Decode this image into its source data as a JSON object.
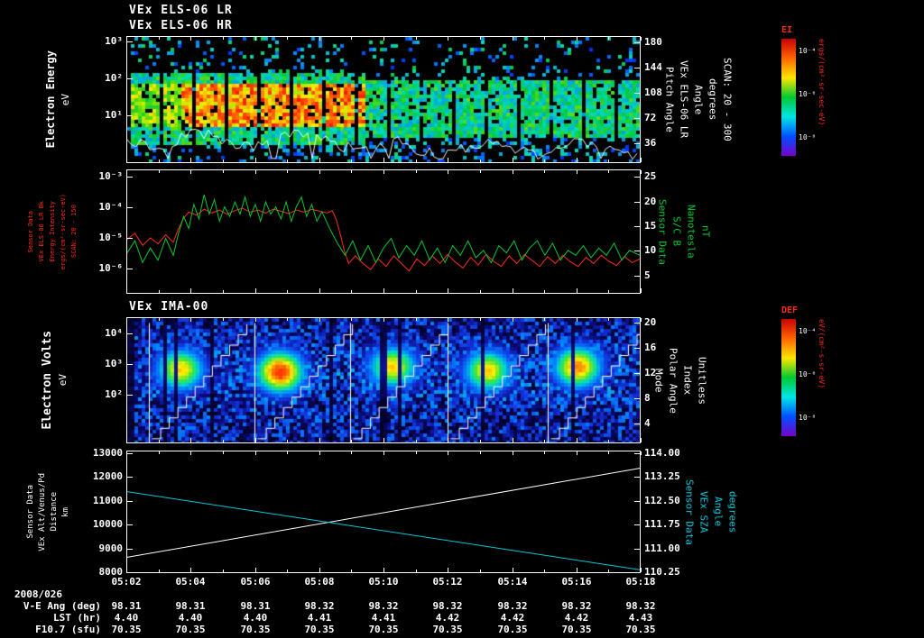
{
  "colors": {
    "background": "#000000",
    "foreground": "#ffffff",
    "red": "#ff2a1a",
    "green": "#00c832",
    "cyan": "#00c8dc",
    "white": "#ffffff"
  },
  "titles": {
    "line1": "VEx ELS-06 LR",
    "line2": "VEx ELS-06 HR",
    "ima": "VEx IMA-00"
  },
  "panel1": {
    "ylabel": "Electron Energy",
    "yunit": "eV",
    "yticks": [
      {
        "t": "10³",
        "f": 0.043
      },
      {
        "t": "10²",
        "f": 0.333
      },
      {
        "t": "10¹",
        "f": 0.624
      }
    ],
    "rticks": [
      {
        "t": "180",
        "f": 0.05
      },
      {
        "t": "144",
        "f": 0.249
      },
      {
        "t": "108",
        "f": 0.448
      },
      {
        "t": "72",
        "f": 0.647
      },
      {
        "t": "36",
        "f": 0.846
      }
    ],
    "side_labels": [
      "Pitch Angle",
      "VEx ELS-06 LR",
      "Angle",
      "degrees",
      "SCAN: 20 - 300"
    ],
    "colorbar": {
      "label": "EI",
      "units": "ergs/(cm²-sr-sec-eV)",
      "ticks": [
        {
          "t": "10⁻⁴",
          "f": 0.1
        },
        {
          "t": "10⁻⁶",
          "f": 0.47
        },
        {
          "t": "10⁻⁸",
          "f": 0.84
        }
      ]
    }
  },
  "panel2": {
    "left_labels": [
      "Sensor Data",
      "VEx ELS-06 LR Bk",
      "Energy Intensity",
      "ergs/(cm²-sr-sec-eV)",
      "SCAN: 20 - 150"
    ],
    "yticks": [
      {
        "t": "10⁻³",
        "f": 0.058
      },
      {
        "t": "10⁻⁴",
        "f": 0.304
      },
      {
        "t": "10⁻⁵",
        "f": 0.551
      },
      {
        "t": "10⁻⁶",
        "f": 0.797
      }
    ],
    "rticks": [
      {
        "t": "25",
        "f": 0.06
      },
      {
        "t": "20",
        "f": 0.258
      },
      {
        "t": "15",
        "f": 0.456
      },
      {
        "t": "10",
        "f": 0.654
      },
      {
        "t": "5",
        "f": 0.852
      }
    ],
    "side_labels": [
      "Sensor Data",
      "S/C B",
      "Nanotesla",
      "nT"
    ]
  },
  "panel3": {
    "ylabel": "Electron Volts",
    "yunit": "eV",
    "yticks": [
      {
        "t": "10⁴",
        "f": 0.129
      },
      {
        "t": "10³",
        "f": 0.371
      },
      {
        "t": "10²",
        "f": 0.614
      }
    ],
    "rticks": [
      {
        "t": "20",
        "f": 0.043
      },
      {
        "t": "16",
        "f": 0.243
      },
      {
        "t": "12",
        "f": 0.443
      },
      {
        "t": "8",
        "f": 0.643
      },
      {
        "t": "4",
        "f": 0.843
      }
    ],
    "side_labels": [
      "Mode",
      "Polar Angle",
      "Index",
      "Unitless"
    ],
    "colorbar": {
      "label": "DEF",
      "units": "eV/(cm²-s-sr-eV)",
      "ticks": [
        {
          "t": "10⁻⁴",
          "f": 0.1
        },
        {
          "t": "10⁻⁶",
          "f": 0.47
        },
        {
          "t": "10⁻⁸",
          "f": 0.84
        }
      ]
    }
  },
  "panel4": {
    "left_labels": [
      "Sensor Data",
      "VEx Alt/Venus/Pd",
      "Distance",
      "km"
    ],
    "yticks": [
      {
        "t": "13000",
        "f": 0.022
      },
      {
        "t": "12000",
        "f": 0.216
      },
      {
        "t": "11000",
        "f": 0.41
      },
      {
        "t": "10000",
        "f": 0.604
      },
      {
        "t": "9000",
        "f": 0.799
      },
      {
        "t": "8000",
        "f": 0.993
      }
    ],
    "rticks": [
      {
        "t": "114.00",
        "f": 0.022
      },
      {
        "t": "113.25",
        "f": 0.216
      },
      {
        "t": "112.50",
        "f": 0.41
      },
      {
        "t": "111.75",
        "f": 0.604
      },
      {
        "t": "111.00",
        "f": 0.799
      },
      {
        "t": "110.25",
        "f": 0.993
      }
    ],
    "side_labels": [
      "Sensor Data",
      "VEx SZA",
      "Angle",
      "degrees"
    ]
  },
  "time_axis": {
    "date": "2008/026",
    "ticks": [
      "05:02",
      "05:04",
      "05:06",
      "05:08",
      "05:10",
      "05:12",
      "05:14",
      "05:16",
      "05:18"
    ]
  },
  "info_rows": [
    {
      "label": "V-E Ang (deg)",
      "values": [
        "98.31",
        "98.31",
        "98.31",
        "98.32",
        "98.32",
        "98.32",
        "98.32",
        "98.32",
        "98.32"
      ]
    },
    {
      "label": "LST (hr)",
      "values": [
        "4.40",
        "4.40",
        "4.40",
        "4.41",
        "4.41",
        "4.42",
        "4.42",
        "4.42",
        "4.43"
      ]
    },
    {
      "label": "F10.7 (sfu)",
      "values": [
        "70.35",
        "70.35",
        "70.35",
        "70.35",
        "70.35",
        "70.35",
        "70.35",
        "70.35",
        "70.35"
      ]
    }
  ],
  "chart_data": [
    {
      "id": "els_spectrogram",
      "type": "heatmap",
      "title": "VEx ELS-06 HR",
      "ylabel": "Electron Energy (eV)",
      "yticks_log": [
        3,
        2,
        1
      ],
      "x_range": [
        "05:02",
        "05:18"
      ],
      "right_axis": {
        "label": "Pitch Angle (degrees)",
        "ticks": [
          180,
          144,
          108,
          72,
          36
        ],
        "scan": "SCAN: 20 - 300"
      },
      "colorbar": {
        "label": "EI",
        "units": "ergs/(cm²-sr-sec-eV)",
        "ticks_log": [
          -4,
          -6,
          -8
        ]
      },
      "features": {
        "seed": 11,
        "hot_band": {
          "x": [
            0.0,
            0.46
          ],
          "y": [
            0.36,
            0.7
          ]
        },
        "gap_period": 9,
        "gap_until": 1.0,
        "trace_base": 0.82
      }
    },
    {
      "id": "els_bk_and_b",
      "type": "line",
      "left_axis": {
        "label": "ergs/(cm²-sr-sec-eV)",
        "scale": "log10",
        "anchors": [
          [
            -3,
            0.058
          ],
          [
            -6,
            0.797
          ]
        ]
      },
      "right_axis": {
        "label": "S/C B (nT)",
        "anchors": [
          [
            25,
            0.06
          ],
          [
            5,
            0.852
          ]
        ]
      },
      "series": [
        {
          "name": "VEx ELS-06 LR Bk Energy Intensity",
          "color": "#ff2a1a",
          "axis": "left",
          "points": [
            [
              0.0,
              -5.05
            ],
            [
              0.015,
              -4.85
            ],
            [
              0.03,
              -5.25
            ],
            [
              0.045,
              -5.0
            ],
            [
              0.06,
              -5.2
            ],
            [
              0.075,
              -4.9
            ],
            [
              0.09,
              -5.15
            ],
            [
              0.1,
              -4.7
            ],
            [
              0.11,
              -4.35
            ],
            [
              0.12,
              -4.15
            ],
            [
              0.135,
              -4.25
            ],
            [
              0.15,
              -4.05
            ],
            [
              0.165,
              -4.18
            ],
            [
              0.18,
              -4.08
            ],
            [
              0.195,
              -4.22
            ],
            [
              0.21,
              -4.1
            ],
            [
              0.225,
              -4.02
            ],
            [
              0.24,
              -4.15
            ],
            [
              0.255,
              -4.08
            ],
            [
              0.27,
              -4.18
            ],
            [
              0.285,
              -4.05
            ],
            [
              0.3,
              -4.12
            ],
            [
              0.315,
              -4.2
            ],
            [
              0.33,
              -4.08
            ],
            [
              0.345,
              -4.15
            ],
            [
              0.36,
              -4.06
            ],
            [
              0.375,
              -4.12
            ],
            [
              0.39,
              -4.18
            ],
            [
              0.4,
              -4.1
            ],
            [
              0.408,
              -4.4
            ],
            [
              0.416,
              -4.9
            ],
            [
              0.424,
              -5.45
            ],
            [
              0.432,
              -5.85
            ],
            [
              0.445,
              -5.6
            ],
            [
              0.46,
              -5.85
            ],
            [
              0.475,
              -6.05
            ],
            [
              0.49,
              -5.7
            ],
            [
              0.505,
              -5.95
            ],
            [
              0.52,
              -5.6
            ],
            [
              0.535,
              -5.85
            ],
            [
              0.55,
              -6.1
            ],
            [
              0.565,
              -5.7
            ],
            [
              0.58,
              -5.92
            ],
            [
              0.595,
              -5.6
            ],
            [
              0.61,
              -5.85
            ],
            [
              0.625,
              -5.55
            ],
            [
              0.64,
              -5.8
            ],
            [
              0.655,
              -6.0
            ],
            [
              0.67,
              -5.65
            ],
            [
              0.685,
              -5.9
            ],
            [
              0.7,
              -5.55
            ],
            [
              0.715,
              -5.78
            ],
            [
              0.73,
              -5.95
            ],
            [
              0.745,
              -5.6
            ],
            [
              0.76,
              -5.85
            ],
            [
              0.775,
              -5.55
            ],
            [
              0.79,
              -5.75
            ],
            [
              0.805,
              -5.95
            ],
            [
              0.82,
              -5.62
            ],
            [
              0.835,
              -5.85
            ],
            [
              0.85,
              -5.58
            ],
            [
              0.865,
              -5.8
            ],
            [
              0.88,
              -5.95
            ],
            [
              0.895,
              -5.65
            ],
            [
              0.91,
              -5.85
            ],
            [
              0.925,
              -5.58
            ],
            [
              0.94,
              -5.78
            ],
            [
              0.955,
              -5.92
            ],
            [
              0.97,
              -5.62
            ],
            [
              0.985,
              -5.82
            ],
            [
              1.0,
              -5.7
            ]
          ]
        },
        {
          "name": "S/C B Nanotesla",
          "color": "#00c832",
          "axis": "right",
          "points": [
            [
              0.0,
              9.5
            ],
            [
              0.015,
              12.0
            ],
            [
              0.03,
              7.5
            ],
            [
              0.045,
              10.5
            ],
            [
              0.06,
              8.0
            ],
            [
              0.075,
              12.5
            ],
            [
              0.09,
              9.0
            ],
            [
              0.1,
              13.5
            ],
            [
              0.11,
              17.0
            ],
            [
              0.12,
              14.5
            ],
            [
              0.13,
              19.5
            ],
            [
              0.14,
              16.5
            ],
            [
              0.15,
              21.5
            ],
            [
              0.16,
              17.5
            ],
            [
              0.17,
              20.5
            ],
            [
              0.18,
              16.0
            ],
            [
              0.19,
              19.0
            ],
            [
              0.2,
              17.0
            ],
            [
              0.21,
              20.0
            ],
            [
              0.22,
              17.5
            ],
            [
              0.23,
              21.0
            ],
            [
              0.24,
              17.0
            ],
            [
              0.25,
              19.5
            ],
            [
              0.26,
              16.0
            ],
            [
              0.27,
              20.0
            ],
            [
              0.28,
              17.5
            ],
            [
              0.29,
              19.0
            ],
            [
              0.3,
              16.5
            ],
            [
              0.31,
              20.0
            ],
            [
              0.32,
              16.0
            ],
            [
              0.33,
              19.0
            ],
            [
              0.34,
              21.0
            ],
            [
              0.35,
              17.0
            ],
            [
              0.36,
              19.5
            ],
            [
              0.37,
              16.0
            ],
            [
              0.38,
              18.0
            ],
            [
              0.395,
              14.5
            ],
            [
              0.41,
              11.5
            ],
            [
              0.425,
              9.0
            ],
            [
              0.44,
              12.0
            ],
            [
              0.455,
              8.0
            ],
            [
              0.47,
              11.0
            ],
            [
              0.485,
              7.5
            ],
            [
              0.5,
              10.5
            ],
            [
              0.515,
              12.5
            ],
            [
              0.53,
              8.5
            ],
            [
              0.545,
              11.0
            ],
            [
              0.56,
              9.0
            ],
            [
              0.575,
              12.0
            ],
            [
              0.59,
              8.0
            ],
            [
              0.605,
              10.5
            ],
            [
              0.62,
              7.5
            ],
            [
              0.635,
              11.0
            ],
            [
              0.65,
              9.0
            ],
            [
              0.665,
              12.0
            ],
            [
              0.68,
              8.5
            ],
            [
              0.695,
              10.0
            ],
            [
              0.71,
              7.5
            ],
            [
              0.725,
              11.0
            ],
            [
              0.74,
              9.5
            ],
            [
              0.755,
              12.0
            ],
            [
              0.77,
              8.0
            ],
            [
              0.785,
              10.5
            ],
            [
              0.8,
              12.0
            ],
            [
              0.815,
              9.0
            ],
            [
              0.83,
              11.5
            ],
            [
              0.845,
              8.0
            ],
            [
              0.86,
              10.0
            ],
            [
              0.875,
              9.0
            ],
            [
              0.89,
              11.0
            ],
            [
              0.905,
              8.5
            ],
            [
              0.92,
              10.5
            ],
            [
              0.935,
              9.0
            ],
            [
              0.95,
              11.5
            ],
            [
              0.965,
              8.0
            ],
            [
              0.98,
              10.0
            ],
            [
              1.0,
              9.0
            ]
          ]
        }
      ]
    },
    {
      "id": "ima_spectrogram",
      "type": "heatmap",
      "title": "VEx IMA-00",
      "ylabel": "Electron Volts (eV)",
      "yticks_log": [
        4,
        3,
        2
      ],
      "right_axis": {
        "label": "Mode / Polar Angle Index (Unitless)",
        "ticks": [
          20,
          16,
          12,
          8,
          4
        ]
      },
      "colorbar": {
        "label": "DEF",
        "units": "eV/(cm²-s-sr-eV)",
        "ticks_log": [
          -4,
          -6,
          -8
        ]
      },
      "features": {
        "seed": 23,
        "blobs": [
          [
            0.1,
            0.4,
            0.85
          ],
          [
            0.295,
            0.42,
            1.0
          ],
          [
            0.515,
            0.38,
            0.85
          ],
          [
            0.7,
            0.41,
            0.85
          ],
          [
            0.875,
            0.38,
            0.92
          ]
        ],
        "sweep_starts": [
          0.042,
          0.248,
          0.435,
          0.625,
          0.82
        ]
      }
    },
    {
      "id": "alt_sza",
      "type": "line",
      "left_axis": {
        "label": "VEx Alt/Venus/Pd Distance (km)",
        "anchors": [
          [
            13000,
            0.022
          ],
          [
            8000,
            0.993
          ]
        ]
      },
      "right_axis": {
        "label": "VEx SZA (degrees)",
        "anchors": [
          [
            114.0,
            0.022
          ],
          [
            110.25,
            0.993
          ]
        ]
      },
      "series": [
        {
          "name": "Altitude",
          "color": "#ffffff",
          "axis": "left",
          "points": [
            [
              0,
              8600
            ],
            [
              1,
              12400
            ]
          ]
        },
        {
          "name": "SZA",
          "color": "#00c8dc",
          "axis": "right",
          "points": [
            [
              0,
              112.8
            ],
            [
              1,
              110.3
            ]
          ]
        }
      ]
    }
  ]
}
